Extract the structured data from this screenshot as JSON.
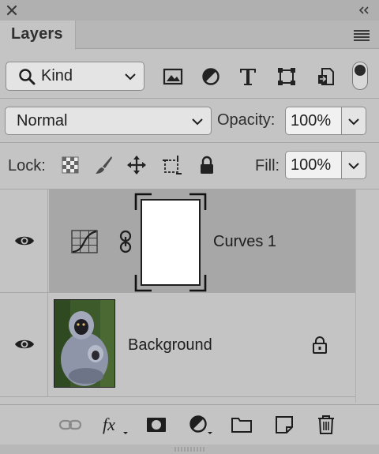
{
  "panel": {
    "tab_label": "Layers",
    "kind_filter": {
      "value": "Kind",
      "icons": [
        "pixel-filter-icon",
        "adjustment-filter-icon",
        "type-filter-icon",
        "shape-filter-icon",
        "smart-object-filter-icon"
      ],
      "filter_enabled": true
    },
    "blend_mode": "Normal",
    "opacity": {
      "label": "Opacity:",
      "value": "100%"
    },
    "lock": {
      "label": "Lock:",
      "icons": [
        "lock-transparent-pixels-icon",
        "lock-image-pixels-icon",
        "lock-position-icon",
        "lock-artboard-icon",
        "lock-all-icon"
      ]
    },
    "fill": {
      "label": "Fill:",
      "value": "100%"
    }
  },
  "layers": [
    {
      "name": "Curves 1",
      "type": "curves-adjustment",
      "visible": true,
      "selected": true,
      "has_mask": true,
      "linked": true
    },
    {
      "name": "Background",
      "type": "image",
      "visible": true,
      "locked": true
    }
  ],
  "bottom_bar": [
    "link-layers-icon",
    "fx-icon",
    "add-mask-icon",
    "new-adjustment-icon",
    "new-group-icon",
    "new-layer-icon",
    "delete-layer-icon"
  ],
  "bottom_bar_labels": {
    "fx": "fx"
  },
  "colors": {
    "panel_bg": "#c4c4c4",
    "selected_row": "#a7a7a7",
    "field_bg": "#e4e4e4"
  }
}
